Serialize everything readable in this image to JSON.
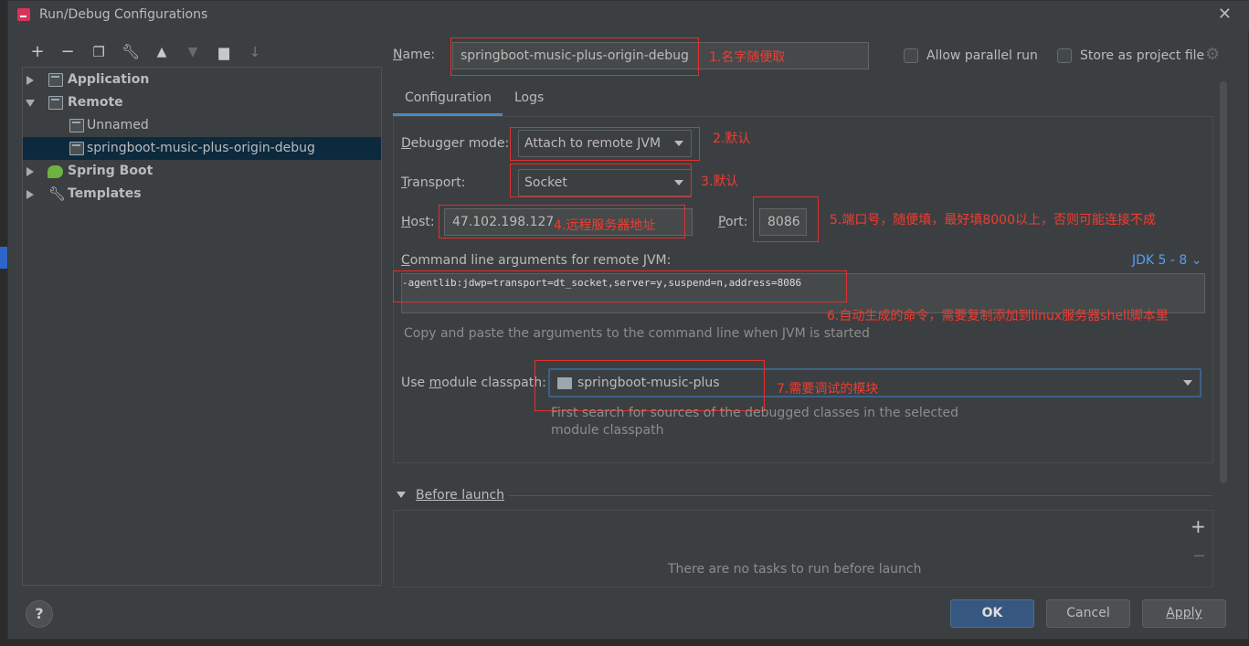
{
  "window": {
    "title": "Run/Debug Configurations"
  },
  "toolbar": {
    "icons": [
      "add-icon",
      "remove-icon",
      "copy-icon",
      "wrench-icon",
      "move-up-icon",
      "move-down-icon",
      "folder-add-icon",
      "sort-icon"
    ]
  },
  "tree": {
    "items": [
      {
        "label": "Application",
        "level": 0,
        "expanded": false,
        "bold": true
      },
      {
        "label": "Remote",
        "level": 0,
        "expanded": true,
        "bold": true
      },
      {
        "label": "Unnamed",
        "level": 1
      },
      {
        "label": "springboot-music-plus-origin-debug",
        "level": 1,
        "selected": true
      },
      {
        "label": "Spring Boot",
        "level": 0,
        "expanded": false,
        "bold": true
      },
      {
        "label": "Templates",
        "level": 0,
        "expanded": false,
        "bold": true
      }
    ]
  },
  "form": {
    "name_label": "Name:",
    "name_value": "springboot-music-plus-origin-debug",
    "allow_parallel": "Allow parallel run",
    "store_project": "Store as project file",
    "tabs": [
      "Configuration",
      "Logs"
    ],
    "debugger_mode_label": "Debugger mode:",
    "debugger_mode_value": "Attach to remote JVM",
    "transport_label": "Transport:",
    "transport_value": "Socket",
    "host_label": "Host:",
    "host_value": "47.102.198.127",
    "port_label": "Port:",
    "port_value": "8086",
    "cmd_label": "Command line arguments for remote JVM:",
    "jdk_label": "JDK 5 - 8",
    "cmd_value": "-agentlib:jdwp=transport=dt_socket,server=y,suspend=n,address=8086",
    "cmd_hint": "Copy and paste the arguments to the command line when JVM is started",
    "module_label": "Use module classpath:",
    "module_value": "springboot-music-plus",
    "module_hint_1": "First search for sources of the debugged classes in the selected",
    "module_hint_2": "module classpath",
    "before_launch": "Before launch",
    "no_tasks": "There are no tasks to run before launch"
  },
  "annotations": {
    "a1": "1.名字随便取",
    "a2": "2.默认",
    "a3": "3.默认",
    "a4": "4.远程服务器地址",
    "a5": "5.端口号，随便填，最好填8000以上，否则可能连接不成",
    "a6": "6.自动生成的命令，需要复制添加到linux服务器shell脚本里",
    "a7": "7.需要调试的模块"
  },
  "buttons": {
    "ok": "OK",
    "cancel": "Cancel",
    "apply": "Apply",
    "help": "?"
  },
  "colors": {
    "accent": "#4a88c7",
    "annotation": "#f03c32",
    "selection": "#0d293e",
    "primary_button": "#365880"
  }
}
